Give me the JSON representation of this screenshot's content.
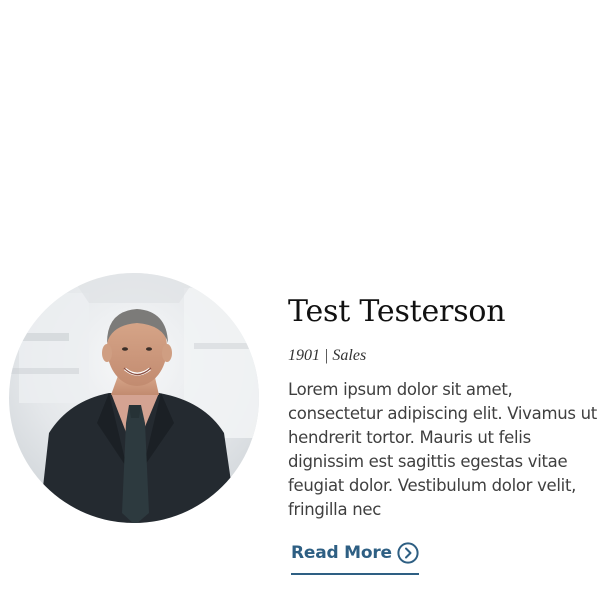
{
  "profile": {
    "photo_icon": "person-photo",
    "name": "Test Testerson",
    "meta": "1901 | Sales",
    "bio_lines": [
      "Lorem ipsum dolor sit amet,",
      "consectetur adipiscing elit. Vivamus ut",
      "hendrerit tortor. Mauris ut felis",
      "dignissim est sagittis egestas vitae",
      "feugiat dolor. Vestibulum dolor velit,",
      "fringilla nec"
    ],
    "read_more_label": "Read More",
    "read_more_icon": "chevron-right-circle-icon"
  },
  "colors": {
    "link": "#2e5f83",
    "heading": "#111111",
    "body_text": "#3f3f3f"
  }
}
